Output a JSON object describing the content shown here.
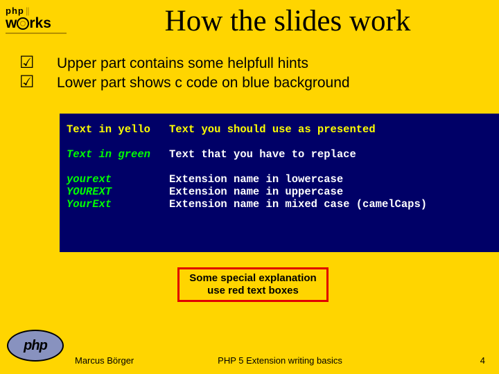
{
  "logo": {
    "brand_top": "php",
    "brand_bottom_pre": "w",
    "brand_bottom_post": "rks"
  },
  "title": "How the slides work",
  "bullets": [
    "Upper part contains some helpfull hints",
    "Lower part shows c code on blue background"
  ],
  "code": {
    "r1": {
      "left": "Text in yello",
      "right": "Text you should use as presented"
    },
    "r2": {
      "left": "Text in green",
      "right": "Text that you have to replace"
    },
    "r3a": {
      "left": "yourext",
      "right": "Extension name in lowercase"
    },
    "r3b": {
      "left": "YOUREXT",
      "right": "Extension name in uppercase"
    },
    "r3c": {
      "left": "YourExt",
      "right": "Extension name in mixed case (camelCaps)"
    }
  },
  "redbox": {
    "l1": "Some special explanation",
    "l2": "use red text boxes"
  },
  "php_logo_text": "php",
  "footer": {
    "left": "Marcus Börger",
    "center": "PHP 5 Extension writing basics",
    "right": "4"
  }
}
